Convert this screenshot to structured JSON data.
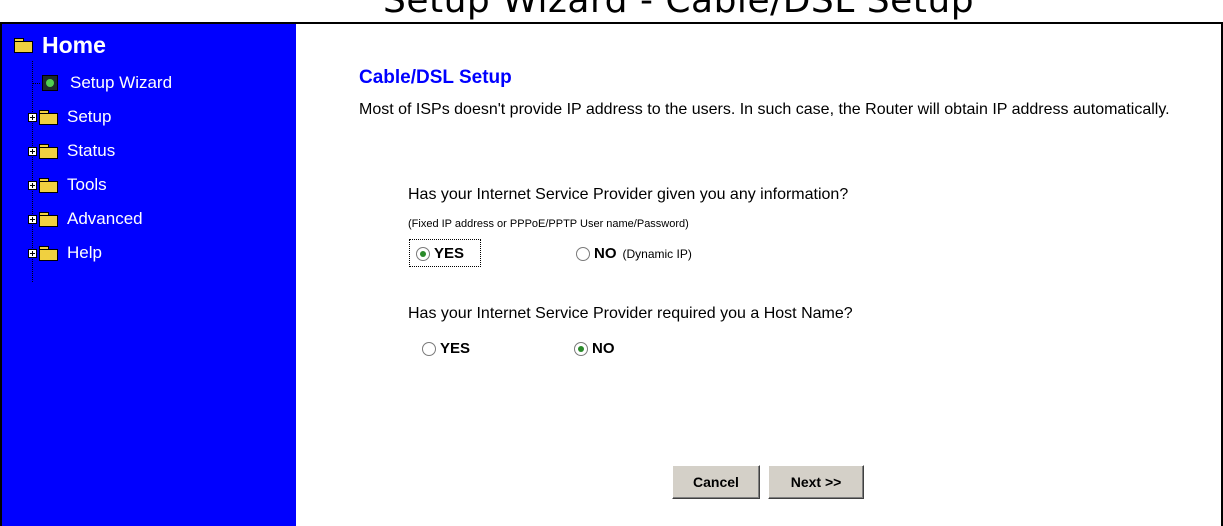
{
  "page": {
    "top_cut_text": "Setup Wizard - Cable/DSL Setup"
  },
  "sidebar": {
    "home_label": "Home",
    "items": [
      {
        "label": "Setup Wizard",
        "icon": "wizard-icon"
      },
      {
        "label": "Setup",
        "icon": "folder-icon"
      },
      {
        "label": "Status",
        "icon": "folder-icon"
      },
      {
        "label": "Tools",
        "icon": "folder-icon"
      },
      {
        "label": "Advanced",
        "icon": "folder-icon"
      },
      {
        "label": "Help",
        "icon": "folder-icon"
      }
    ],
    "bg_color": "#0000ff"
  },
  "main": {
    "title": "Cable/DSL Setup",
    "intro": "Most of ISPs doesn't provide IP address to the users. In such case, the Router will obtain IP address automatically.",
    "question1": {
      "text": "Has your Internet Service Provider given you any information?",
      "hint": "(Fixed IP address or PPPoE/PPTP User name/Password)",
      "yes_label": "YES",
      "no_label": "NO",
      "no_sub": "(Dynamic IP)",
      "selected": "YES"
    },
    "question2": {
      "text": "Has your Internet Service Provider required  you a Host Name?",
      "yes_label": "YES",
      "no_label": "NO",
      "selected": "NO"
    },
    "buttons": {
      "cancel_label": "Cancel",
      "next_label": "Next >>"
    }
  }
}
